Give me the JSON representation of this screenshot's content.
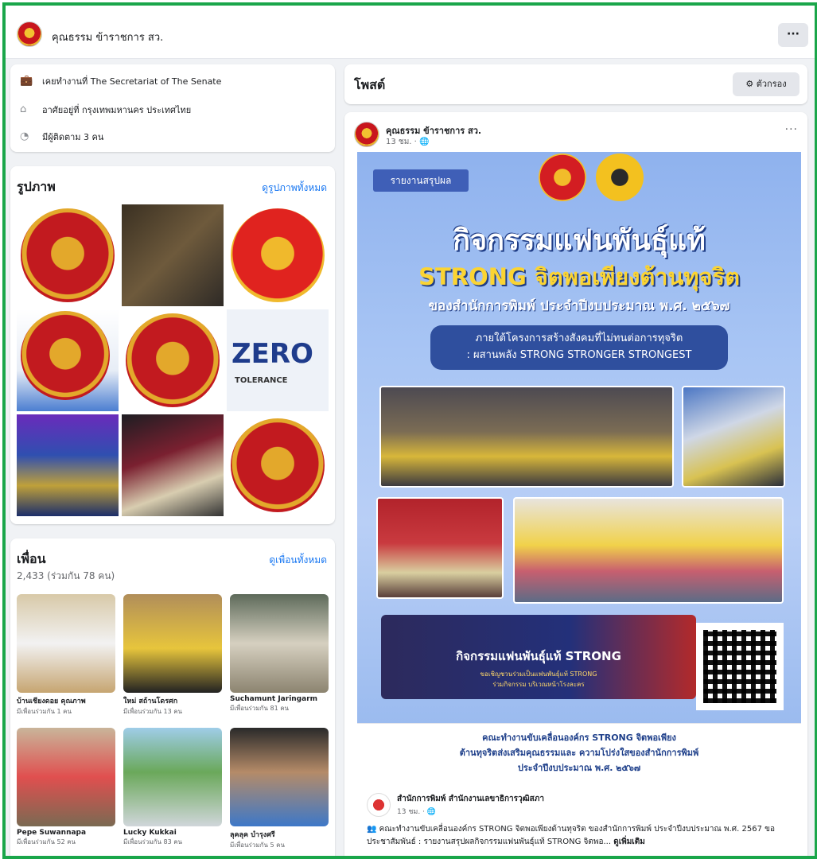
{
  "page": {
    "name": "คุณธรรม ข้าราชการ สว.",
    "more_label": "···"
  },
  "intro": {
    "work": "เคยทำงานที่ The Secretariat of The Senate",
    "lives": "อาศัยอยู่ที่ กรุงเทพมหานคร ประเทศไทย",
    "followers": "มีผู้ติดตาม 3 คน"
  },
  "photos": {
    "title": "รูปภาพ",
    "see_all": "ดูรูปภาพทั้งหมด",
    "zero_text": "ZERO",
    "tolerance_text": "TOLERANCE"
  },
  "friends": {
    "title": "เพื่อน",
    "count": "2,433 (ร่วมกัน 78 คน)",
    "see_all": "ดูเพื่อนทั้งหมด",
    "items": [
      {
        "name": "บ้านเชียงดอย คุณภาพ",
        "mutual": "มีเพื่อนร่วมกัน 1 คน"
      },
      {
        "name": "ใหม่ สถ้านโดรศก",
        "mutual": "มีเพื่อนร่วมกัน 13 คน"
      },
      {
        "name": "Suchamunt Jaringarm",
        "mutual": "มีเพื่อนร่วมกัน 81 คน"
      },
      {
        "name": "Pepe Suwannapa",
        "mutual": "มีเพื่อนร่วมกัน 52 คน"
      },
      {
        "name": "Lucky Kukkai",
        "mutual": "มีเพื่อนร่วมกัน 83 คน"
      },
      {
        "name": "ลุคลุค บำรุงศรี",
        "mutual": "มีเพื่อนร่วมกัน 5 คน"
      }
    ]
  },
  "posts": {
    "title": "โพสต์",
    "filter_label": "ตัวกรอง"
  },
  "post": {
    "author": "คุณธรรม ข้าราชการ สว.",
    "time": "13 ชม. · 🌐",
    "poster": {
      "tag": "รายงานสรุปผล",
      "title1": "กิจกรรมแฟนพันธุ์แท้",
      "title2": "STRONG จิตพอเพียงต้านทุจริต",
      "title3": "ของสำนักการพิมพ์ ประจำปีงบประมาณ พ.ศ. ๒๕๖๗",
      "sub1": "ภายใต้โครงการสร้างสังคมที่ไม่ทนต่อการทุจริต",
      "sub2": ": ผสานพลัง STRONG STRONGER STRONGEST",
      "banner_main": "กิจกรรมแฟนพันธุ์แท้ STRONG",
      "banner_sub1": "ขอเชิญชวนร่วมเป็นแฟนพันธุ์แท้ STRONG",
      "banner_sub2": "ร่วมกิจกรรม บริเวณหน้าโรงละคร"
    },
    "caption": [
      "คณะทำงานขับเคลื่อนองค์กร STRONG จิตพอเพียง",
      "ต้านทุจริตส่งเสริมคุณธรรมและ ความโปร่งใสของสำนักการพิมพ์",
      "ประจำปีงบประมาณ พ.ศ. ๒๕๖๗"
    ],
    "shared": {
      "author": "สำนักการพิมพ์ สำนักงานเลขาธิการวุฒิสภา",
      "time": "13 ชม. · 🌐",
      "text": "👥 คณะทำงานขับเคลื่อนองค์กร STRONG จิตพอเพียงต้านทุจริต ของสำนักการพิมพ์ ประจำปีงบประมาณ พ.ศ. 2567 ขอประชาสัมพันธ์ : รายงานสรุปผลกิจกรรมแฟนพันธุ์แท้ STRONG จิตพอ... ",
      "see_more": "ดูเพิ่มเติม"
    }
  },
  "colors": {
    "frame": "#1aa64a",
    "link": "#1877f2",
    "poster_gold": "#fbd433"
  }
}
